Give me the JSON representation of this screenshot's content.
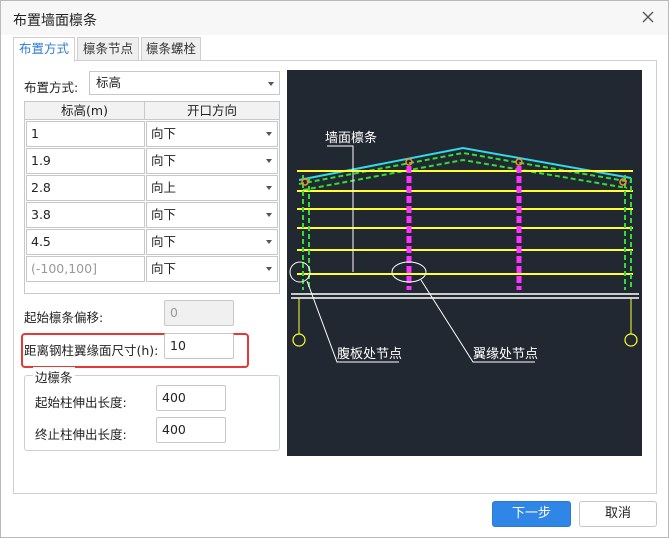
{
  "window": {
    "title": "布置墙面檩条"
  },
  "tabs": [
    {
      "label": "布置方式",
      "active": true
    },
    {
      "label": "檩条节点",
      "active": false
    },
    {
      "label": "檩条螺栓",
      "active": false
    }
  ],
  "layout_mode": {
    "label": "布置方式:",
    "value": "标高"
  },
  "table": {
    "headers": [
      "标高(m)",
      "开口方向"
    ],
    "rows": [
      {
        "elevation": "1",
        "direction": "向下"
      },
      {
        "elevation": "1.9",
        "direction": "向下"
      },
      {
        "elevation": "2.8",
        "direction": "向上"
      },
      {
        "elevation": "3.8",
        "direction": "向下"
      },
      {
        "elevation": "4.5",
        "direction": "向下"
      },
      {
        "elevation": "",
        "placeholder": "(-100,100]",
        "direction": "向下"
      }
    ]
  },
  "start_offset": {
    "label": "起始檩条偏移:",
    "value": "0"
  },
  "flange_distance": {
    "label": "距离钢柱翼缘面尺寸(h):",
    "value": "10"
  },
  "edge_purlin": {
    "title": "边檩条",
    "start_label": "起始柱伸出长度:",
    "start_value": "400",
    "end_label": "终止柱伸出长度:",
    "end_value": "400"
  },
  "preview": {
    "labels": {
      "wall_purlin": "墙面檩条",
      "web_node": "腹板处节点",
      "flange_node": "翼缘处节点"
    },
    "colors": {
      "background": "#222831",
      "purlin": "#ffff33",
      "roof": "#33d9e6",
      "column": "#33dd33",
      "mid_column": "#ff33ff",
      "annotation": "#ffffff"
    }
  },
  "buttons": {
    "next": "下一步",
    "cancel": "取消"
  },
  "colors": {
    "accent": "#2f86e6",
    "highlight_border": "#e53935"
  }
}
